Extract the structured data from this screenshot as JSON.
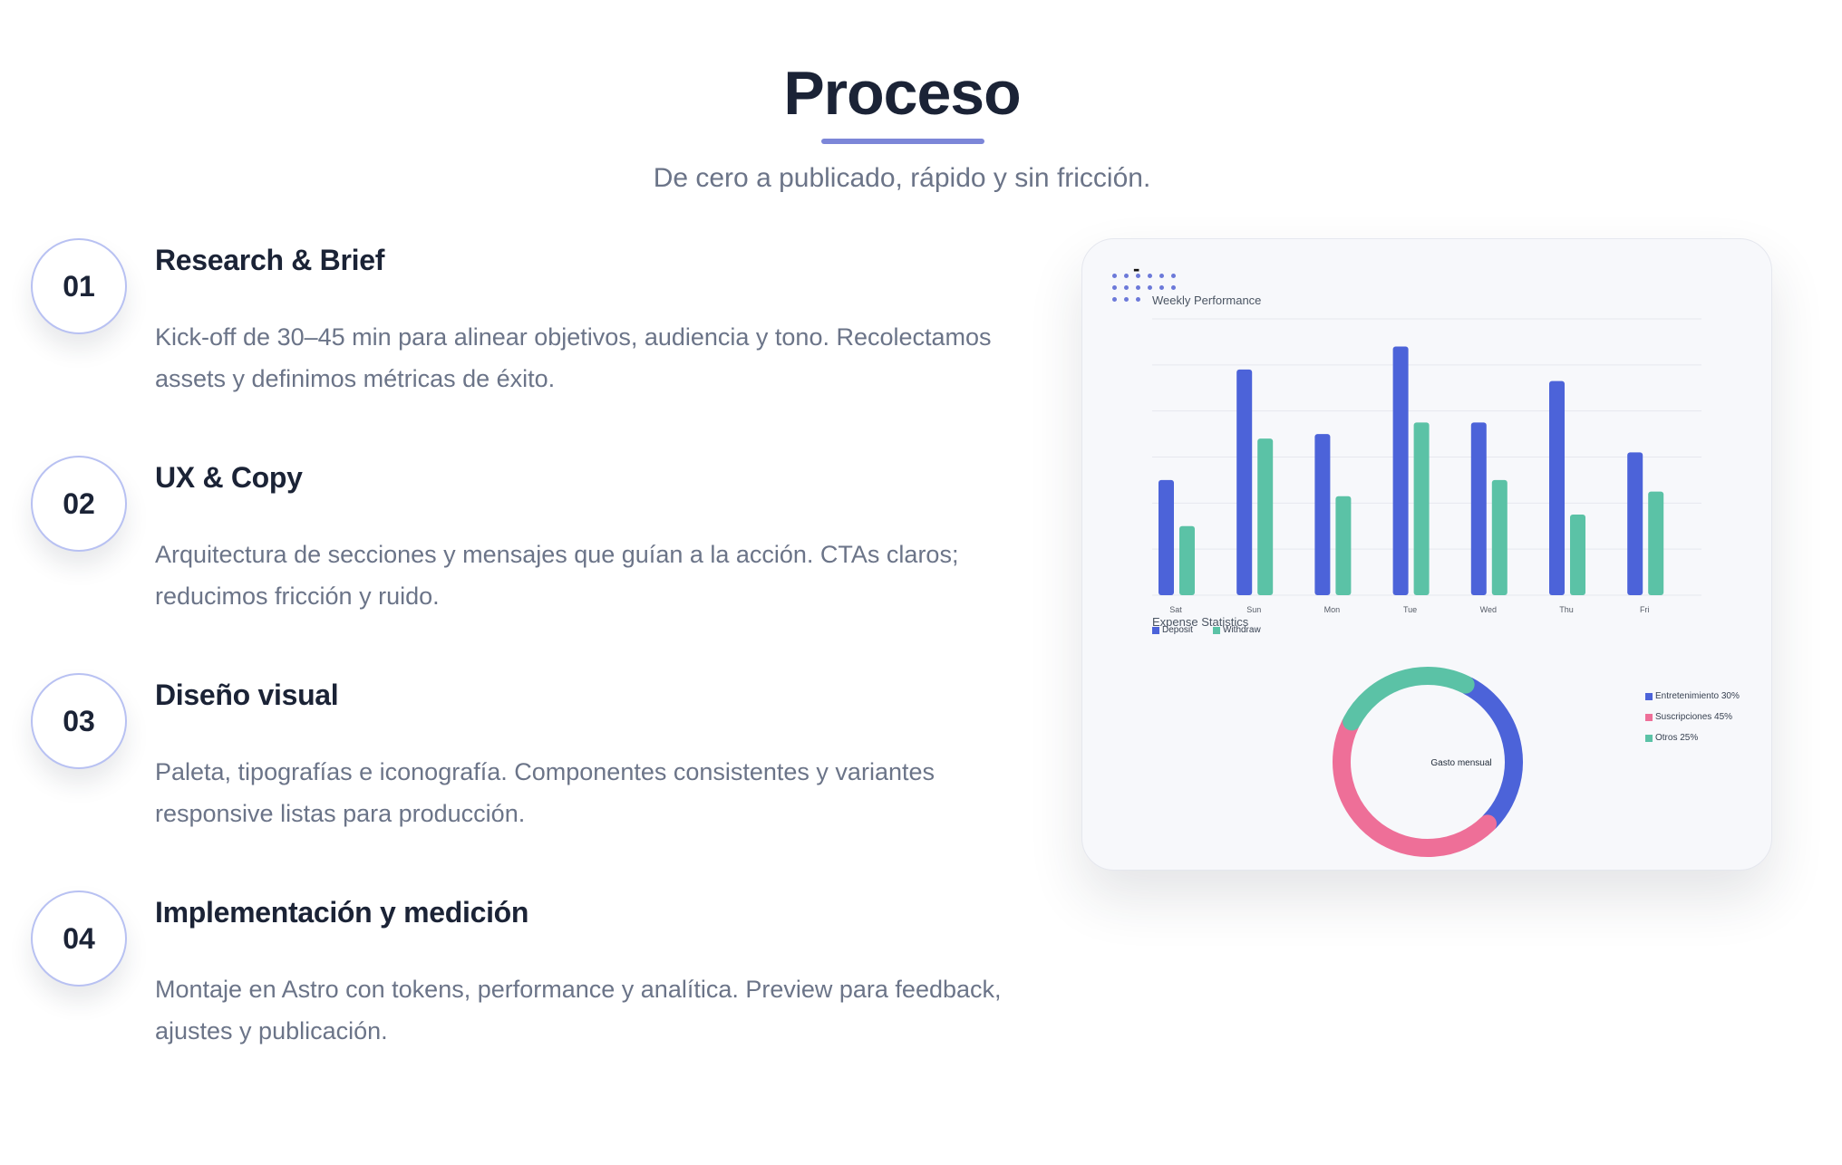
{
  "header": {
    "title": "Proceso",
    "subtitle": "De cero a publicado, rápido y sin fricción."
  },
  "steps": [
    {
      "number": "01",
      "title": "Research & Brief",
      "description": "Kick-off de 30–45 min para alinear objetivos, audiencia y tono. Recolectamos assets y definimos métricas de éxito."
    },
    {
      "number": "02",
      "title": "UX & Copy",
      "description": "Arquitectura de secciones y mensajes que guían a la acción. CTAs claros; reducimos fricción y ruido."
    },
    {
      "number": "03",
      "title": "Diseño visual",
      "description": "Paleta, tipografías e iconografía. Componentes consistentes y variantes responsive listas para producción."
    },
    {
      "number": "04",
      "title": "Implementación y medición",
      "description": "Montaje en Astro con tokens, performance y analítica. Preview para feedback, ajustes y publicación."
    }
  ],
  "card": {
    "dash": "-"
  },
  "colors": {
    "deposit": "#4c63d9",
    "withdraw": "#5bc2a6",
    "suscripciones": "#ee6f98",
    "accent": "#7c86d8"
  },
  "chart_data": [
    {
      "type": "bar",
      "title": "Weekly Performance",
      "categories": [
        "Sat",
        "Sun",
        "Mon",
        "Tue",
        "Wed",
        "Thu",
        "Fri"
      ],
      "series": [
        {
          "name": "Deposit",
          "values": [
            250,
            490,
            350,
            540,
            375,
            465,
            310
          ]
        },
        {
          "name": "Withdraw",
          "values": [
            150,
            340,
            215,
            375,
            250,
            175,
            225
          ]
        }
      ],
      "ylim": [
        0,
        600
      ],
      "grid": true,
      "legend": "bottom-left"
    },
    {
      "type": "pie",
      "title": "Expense Statistics",
      "center_label": "Gasto mensual",
      "labels": [
        "Entretenimiento 30%",
        "Suscripciones 45%",
        "Otros 25%"
      ],
      "values": [
        30,
        45,
        25
      ],
      "legend": "right"
    }
  ]
}
